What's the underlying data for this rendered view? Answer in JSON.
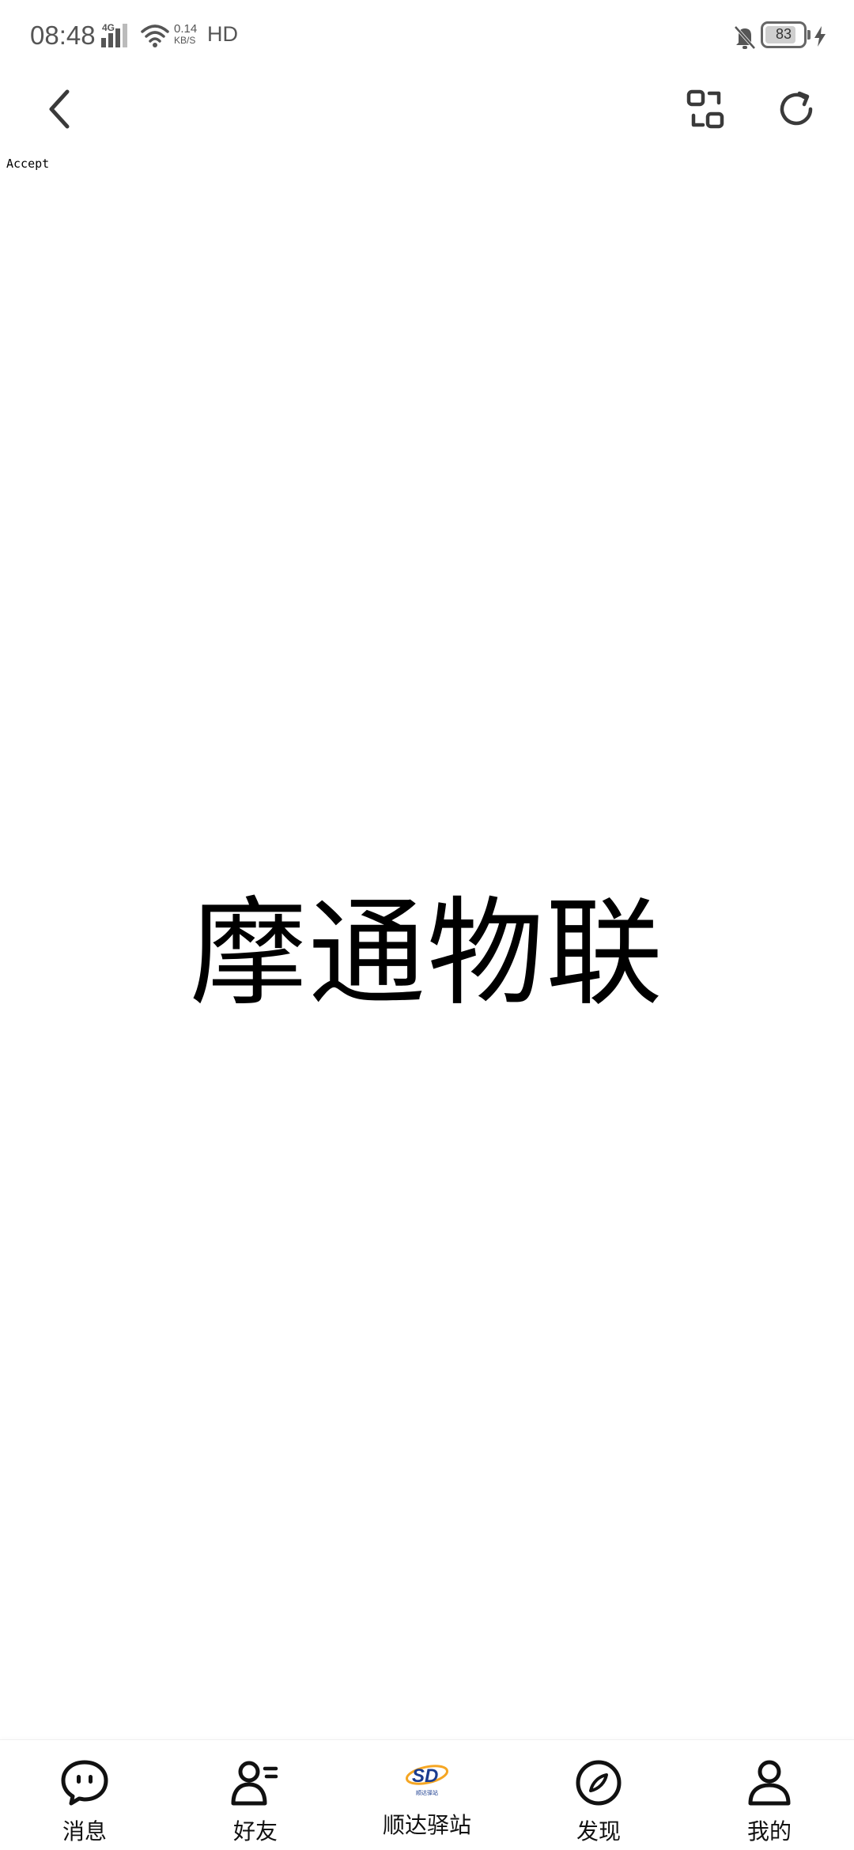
{
  "status_bar": {
    "time": "08:48",
    "network": "4G",
    "speed_value": "0.14",
    "speed_unit": "KB/S",
    "hd": "HD",
    "battery": "83",
    "battery_level": 0.83
  },
  "header": {
    "back_icon": "chevron-left-icon",
    "switch_icon": "switch-icon",
    "refresh_icon": "refresh-icon"
  },
  "page": {
    "accept_text": "Accept",
    "title": "摩通物联"
  },
  "nav": {
    "items": [
      {
        "label": "消息",
        "icon": "message-icon"
      },
      {
        "label": "好友",
        "icon": "friends-icon"
      },
      {
        "label": "顺达驿站",
        "icon": "sd-logo",
        "logo_caption": "顺达驿站"
      },
      {
        "label": "发现",
        "icon": "compass-icon"
      },
      {
        "label": "我的",
        "icon": "profile-icon"
      }
    ]
  },
  "colors": {
    "icon": "#3a3a3a",
    "logo_blue": "#1a3c8f",
    "logo_orange": "#f5a623"
  }
}
